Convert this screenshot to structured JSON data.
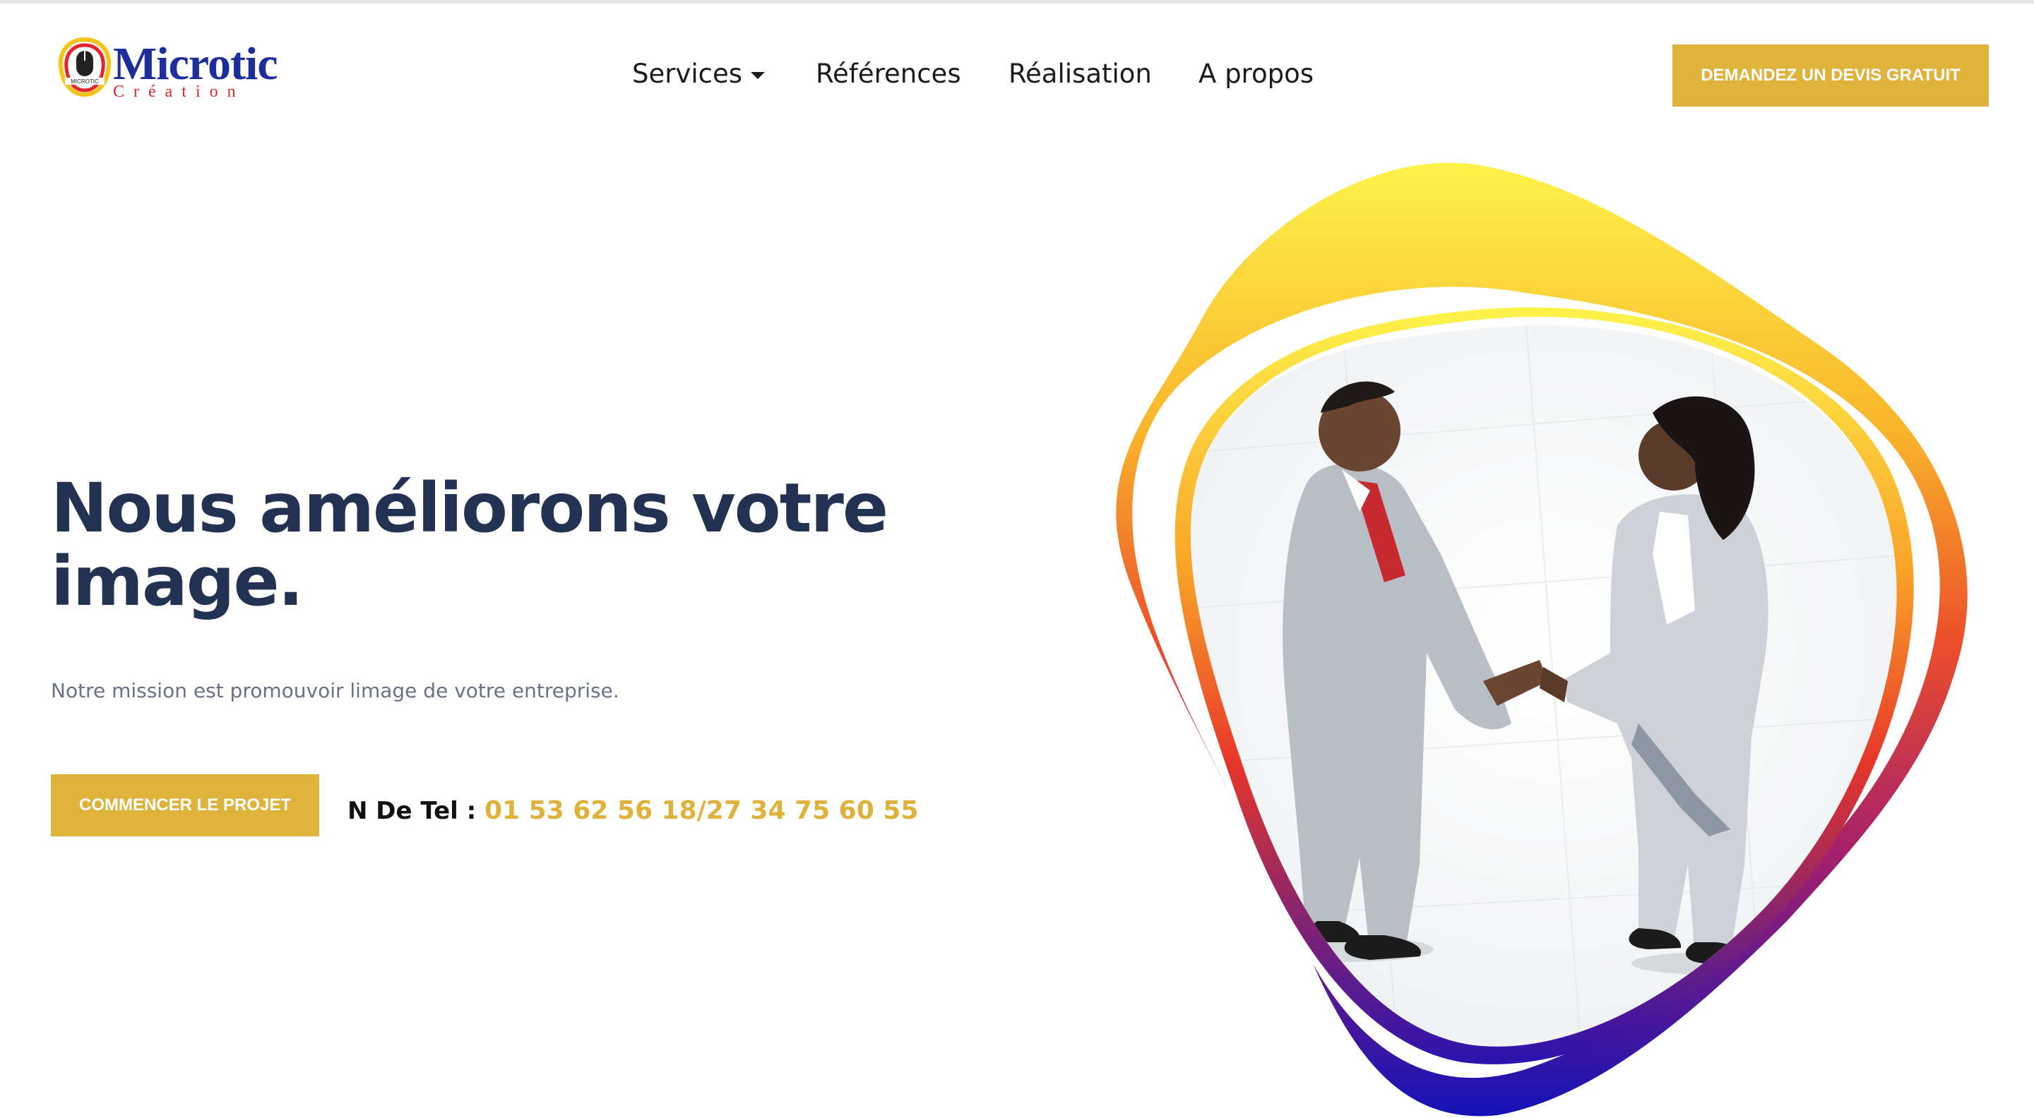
{
  "brand": {
    "name": "Microtic",
    "tagline": "Création",
    "badge": "MICROTIC",
    "logo_icon": "mouse-icon"
  },
  "nav": {
    "items": [
      {
        "label": "Services",
        "has_dropdown": true
      },
      {
        "label": "Références"
      },
      {
        "label": "Réalisation"
      },
      {
        "label": "A propos"
      }
    ],
    "dropdown_icon": "chevron-down-icon"
  },
  "header": {
    "cta_label": "DEMANDEZ UN DEVIS GRATUIT"
  },
  "hero": {
    "title": "Nous améliorons votre image.",
    "subtitle": "Notre mission est promouvoir limage de votre entreprise.",
    "start_label": "COMMENCER LE PROJET",
    "tel_label": "N De Tel :",
    "tel_value": "01 53 62 56 18/27 34 75 60 55",
    "image_alt": "handshake-photo"
  },
  "colors": {
    "accent": "#dfb23c",
    "heading": "#233152",
    "muted": "#6b7186",
    "brand_blue": "#1d2d9c",
    "brand_red": "#e3262a",
    "shape_yellow": "#fdf24a",
    "shape_orange": "#f7921e",
    "shape_red": "#e62b29",
    "shape_purple": "#6a1a9a",
    "shape_blue": "#1312b7"
  }
}
